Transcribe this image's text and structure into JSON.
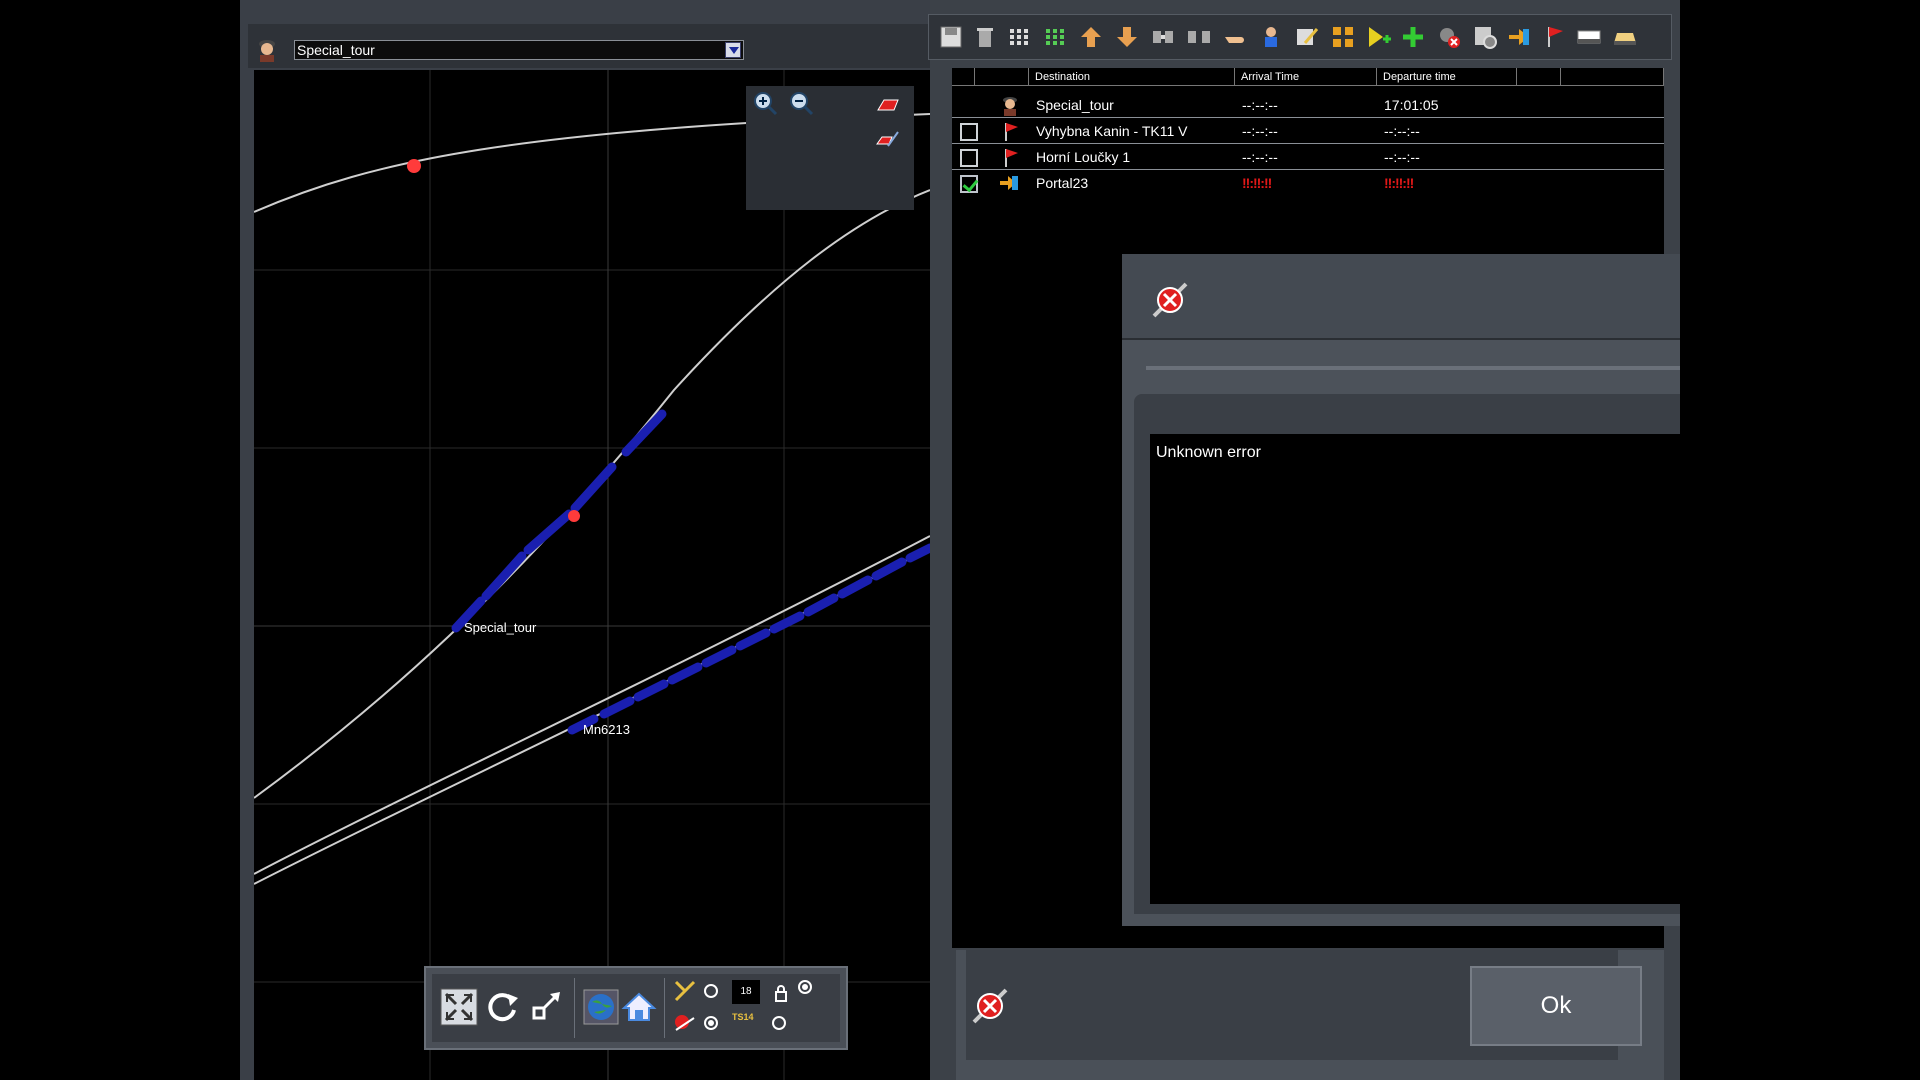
{
  "map": {
    "selected_train": "Special_tour",
    "train_labels": {
      "primary": "Special_tour",
      "secondary": "Mn6213"
    }
  },
  "toolbar": {
    "tools": [
      "save-icon",
      "trash-icon",
      "grid-small-icon",
      "grid-green-icon",
      "move-up-icon",
      "move-down-icon",
      "couple-icon",
      "decouple-icon",
      "hand-icon",
      "driver-icon",
      "edit-list-icon",
      "grid-yellow-icon",
      "add-destination-icon",
      "add-icon",
      "remove-icon",
      "settings-icon",
      "portal-icon",
      "flag-icon",
      "bar-icon",
      "train-icon"
    ]
  },
  "schedule": {
    "columns": [
      "Destination",
      "Arrival Time",
      "Departure time"
    ],
    "rows": [
      {
        "icon": "driver-icon",
        "destination": "Special_tour",
        "arrival": "--:--:--",
        "departure": "17:01:05",
        "checkbox": null
      },
      {
        "icon": "flag-icon",
        "destination": "Vyhybna Kanin - TK11 V",
        "arrival": "--:--:--",
        "departure": "--:--:--",
        "checkbox": false
      },
      {
        "icon": "flag-icon",
        "destination": "Horní Loučky 1",
        "arrival": "--:--:--",
        "departure": "--:--:--",
        "checkbox": false
      },
      {
        "icon": "portal-icon",
        "destination": "Portal23",
        "arrival": "!!:!!:!!",
        "departure": "!!:!!:!!",
        "checkbox": true
      }
    ]
  },
  "error_dialog": {
    "message": "Unknown error"
  },
  "footer": {
    "ok_label": "Ok"
  },
  "bottom_toolbar": {
    "speed_value": "18",
    "label_a": "TS14"
  },
  "colors": {
    "train_blue": "#1a1fb0",
    "marker_red": "#ff3b3b",
    "error_red": "#e01818",
    "check_green": "#2ecc40"
  }
}
